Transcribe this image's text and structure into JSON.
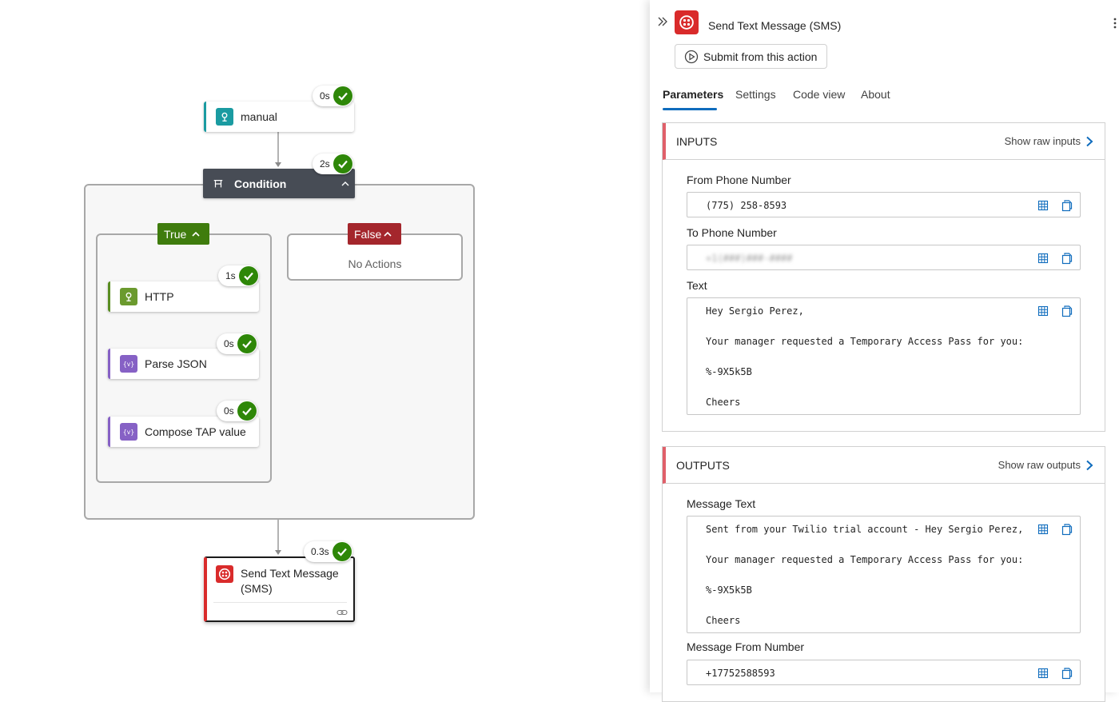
{
  "canvas": {
    "manual": {
      "label": "manual",
      "duration": "0s"
    },
    "condition": {
      "label": "Condition",
      "duration": "2s"
    },
    "true_branch": {
      "label": "True"
    },
    "false_branch": {
      "label": "False",
      "empty_text": "No Actions"
    },
    "http": {
      "label": "HTTP",
      "duration": "1s"
    },
    "parse_json": {
      "label": "Parse JSON",
      "duration": "0s"
    },
    "compose": {
      "label": "Compose TAP value",
      "duration": "0s"
    },
    "send_sms": {
      "label_line1": "Send Text Message",
      "label_line2": "(SMS)",
      "duration": "0.3s"
    },
    "colors": {
      "success": "#2e8708",
      "condition_bg": "#474c55",
      "true": "#3f7c0d",
      "false": "#a4262c",
      "twilio": "#d92b2b",
      "trigger": "#1a9ba1",
      "data_ops": "#8661c5"
    }
  },
  "panel": {
    "title": "Send Text Message (SMS)",
    "submit_label": "Submit from this action",
    "tabs": [
      "Parameters",
      "Settings",
      "Code view",
      "About"
    ],
    "active_tab": "Parameters",
    "inputs": {
      "header": "INPUTS",
      "raw_link": "Show raw inputs",
      "from_label": "From Phone Number",
      "from_value": "(775) 258-8593",
      "to_label": "To Phone Number",
      "to_value": "+1(###)###-####",
      "text_label": "Text",
      "text_lines": [
        "Hey Sergio Perez,",
        "Your manager requested a Temporary Access Pass for you:",
        "%-9X5k5B",
        "Cheers"
      ]
    },
    "outputs": {
      "header": "OUTPUTS",
      "raw_link": "Show raw outputs",
      "message_text_label": "Message Text",
      "message_text_lines": [
        "Sent from your Twilio trial account - Hey Sergio Perez,",
        "Your manager requested a Temporary Access Pass for you:",
        "%-9X5k5B",
        "Cheers"
      ],
      "from_number_label": "Message From Number",
      "from_number_value": "+17752588593"
    }
  }
}
